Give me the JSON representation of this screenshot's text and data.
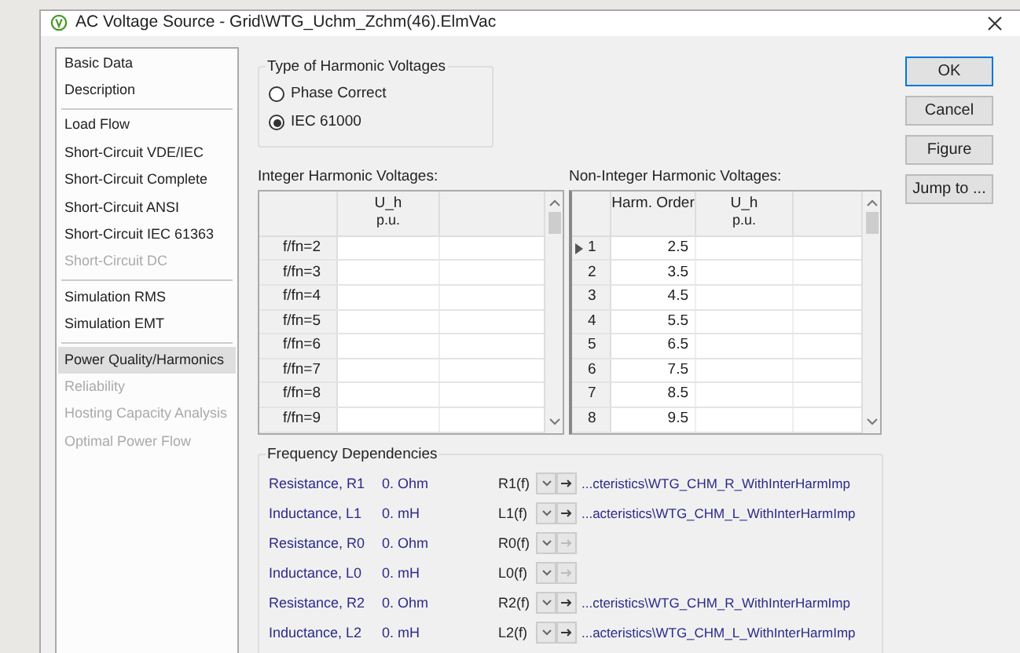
{
  "window": {
    "title": "AC Voltage Source - Grid\\WTG_Uchm_Zchm(46).ElmVac"
  },
  "sidebar": {
    "groups": [
      [
        {
          "label": "Basic Data",
          "selected": false,
          "disabled": false
        },
        {
          "label": "Description",
          "selected": false,
          "disabled": false
        }
      ],
      [
        {
          "label": "Load Flow",
          "selected": false,
          "disabled": false
        },
        {
          "label": "Short-Circuit VDE/IEC",
          "selected": false,
          "disabled": false
        },
        {
          "label": "Short-Circuit Complete",
          "selected": false,
          "disabled": false
        },
        {
          "label": "Short-Circuit ANSI",
          "selected": false,
          "disabled": false
        },
        {
          "label": "Short-Circuit IEC 61363",
          "selected": false,
          "disabled": false
        },
        {
          "label": "Short-Circuit DC",
          "selected": false,
          "disabled": true
        }
      ],
      [
        {
          "label": "Simulation RMS",
          "selected": false,
          "disabled": false
        },
        {
          "label": "Simulation EMT",
          "selected": false,
          "disabled": false
        }
      ],
      [
        {
          "label": "Power Quality/Harmonics",
          "selected": true,
          "disabled": false
        },
        {
          "label": "Reliability",
          "selected": false,
          "disabled": true
        },
        {
          "label": "Hosting Capacity Analysis",
          "selected": false,
          "disabled": true
        },
        {
          "label": "Optimal Power Flow",
          "selected": false,
          "disabled": true
        }
      ]
    ]
  },
  "harmonic_type": {
    "title": "Type of Harmonic Voltages",
    "options": [
      {
        "label": "Phase Correct",
        "selected": false
      },
      {
        "label": "IEC 61000",
        "selected": true
      }
    ]
  },
  "integer_table": {
    "title": "Integer Harmonic Voltages:",
    "columns": [
      {
        "name": "U_h",
        "unit": "p.u."
      }
    ],
    "rows": [
      {
        "label": "f/fn=2"
      },
      {
        "label": "f/fn=3"
      },
      {
        "label": "f/fn=4"
      },
      {
        "label": "f/fn=5"
      },
      {
        "label": "f/fn=6"
      },
      {
        "label": "f/fn=7"
      },
      {
        "label": "f/fn=8"
      },
      {
        "label": "f/fn=9"
      }
    ]
  },
  "non_integer_table": {
    "title": "Non-Integer Harmonic Voltages:",
    "columns": [
      {
        "name": "Harm. Order"
      },
      {
        "name": "U_h",
        "unit": "p.u."
      }
    ],
    "rows": [
      {
        "index": "1",
        "order": "2.5",
        "selected": true
      },
      {
        "index": "2",
        "order": "3.5",
        "selected": false
      },
      {
        "index": "3",
        "order": "4.5",
        "selected": false
      },
      {
        "index": "4",
        "order": "5.5",
        "selected": false
      },
      {
        "index": "5",
        "order": "6.5",
        "selected": false
      },
      {
        "index": "6",
        "order": "7.5",
        "selected": false
      },
      {
        "index": "7",
        "order": "8.5",
        "selected": false
      },
      {
        "index": "8",
        "order": "9.5",
        "selected": false
      }
    ]
  },
  "buttons": [
    {
      "label": "OK",
      "default": true
    },
    {
      "label": "Cancel",
      "default": false
    },
    {
      "label": "Figure",
      "default": false
    },
    {
      "label": "Jump to ...",
      "default": false
    }
  ],
  "frequency_dependencies": {
    "title": "Frequency Dependencies",
    "rows": [
      {
        "label": "Resistance, R1",
        "value": "0. Ohm",
        "function": "R1(f)",
        "jump_disabled": false,
        "path": "...cteristics\\WTG_CHM_R_WithInterHarmImp"
      },
      {
        "label": "Inductance, L1",
        "value": "0. mH",
        "function": "L1(f)",
        "jump_disabled": false,
        "path": "...acteristics\\WTG_CHM_L_WithInterHarmImp"
      },
      {
        "label": "Resistance, R0",
        "value": "0. Ohm",
        "function": "R0(f)",
        "jump_disabled": true
      },
      {
        "label": "Inductance, L0",
        "value": "0. mH",
        "function": "L0(f)",
        "jump_disabled": true
      },
      {
        "label": "Resistance, R2",
        "value": "0. Ohm",
        "function": "R2(f)",
        "jump_disabled": false,
        "path": "...cteristics\\WTG_CHM_R_WithInterHarmImp"
      },
      {
        "label": "Inductance, L2",
        "value": "0. mH",
        "function": "L2(f)",
        "jump_disabled": false,
        "path": "...acteristics\\WTG_CHM_L_WithInterHarmImp"
      }
    ]
  }
}
